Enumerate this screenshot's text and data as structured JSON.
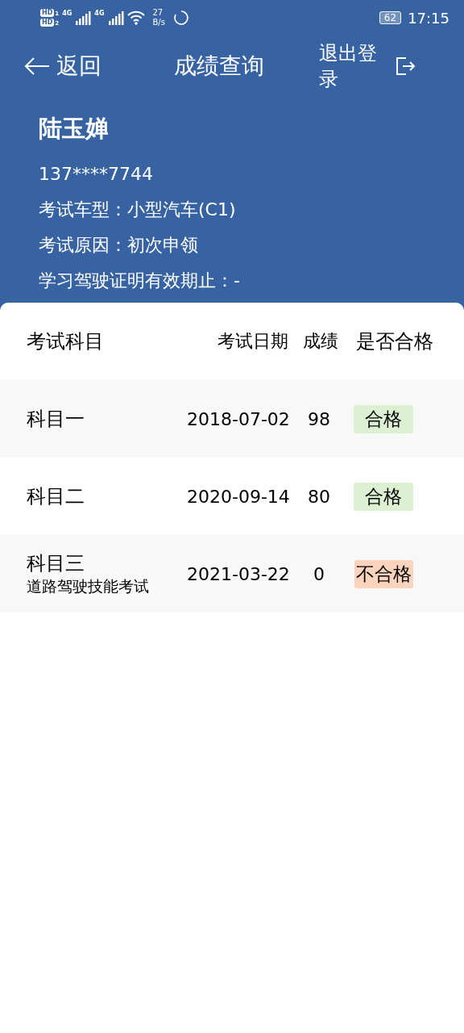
{
  "status_bar": {
    "sims": [
      {
        "label": "HD",
        "slot": "1"
      },
      {
        "label": "HD",
        "slot": "2"
      }
    ],
    "networks": [
      "4G",
      "4G"
    ],
    "speed": "27",
    "speed_unit": "B/s",
    "battery": "62",
    "time": "17:15"
  },
  "nav": {
    "back": "返回",
    "title": "成绩查询",
    "logout": "退出登录"
  },
  "profile": {
    "name": "陆玉婵",
    "phone": "137****7744",
    "lines": [
      "考试车型：小型汽车(C1)",
      "考试原因：初次申领",
      "学习驾驶证明有效期止：-"
    ]
  },
  "table": {
    "columns": [
      "考试科目",
      "考试日期",
      "成绩",
      "是否合格"
    ],
    "rows": [
      {
        "subject": "科目一",
        "detail": "",
        "date": "2018-07-02",
        "score": "98",
        "result": "合格",
        "passed": true
      },
      {
        "subject": "科目二",
        "detail": "",
        "date": "2020-09-14",
        "score": "80",
        "result": "合格",
        "passed": true
      },
      {
        "subject": "科目三",
        "detail": "道路驾驶技能考试",
        "date": "2021-03-22",
        "score": "0",
        "result": "不合格",
        "passed": false
      }
    ]
  }
}
